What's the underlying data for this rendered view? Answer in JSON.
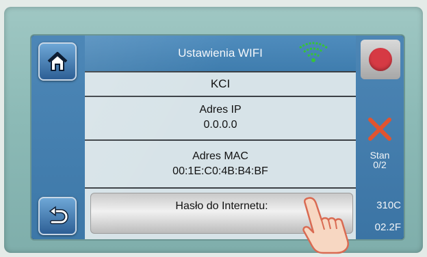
{
  "header": {
    "title": "Ustawienia WIFI"
  },
  "network": {
    "name": "KCI"
  },
  "ip": {
    "label": "Adres IP",
    "value": "0.0.0.0"
  },
  "mac": {
    "label": "Adres MAC",
    "value": "00:1E:C0:4B:B4:BF"
  },
  "password": {
    "label": "Hasło do Internetu:"
  },
  "status": {
    "label": "Stan",
    "value": "0/2"
  },
  "readings": {
    "temp1": "310C",
    "temp2": "02.2F"
  },
  "icons": {
    "home": "home-icon",
    "back": "back-arrow-icon",
    "wifi": "wifi-icon",
    "record": "record-icon",
    "status": "close-x-icon",
    "hand": "pointing-hand"
  },
  "colors": {
    "screen_blue": "#3f7dae",
    "row_bg": "#d7e3e8",
    "wifi_green": "#37c23b",
    "record_red": "#d63a44",
    "x_orange": "#e2542f",
    "bezel": "#8cbab6"
  }
}
